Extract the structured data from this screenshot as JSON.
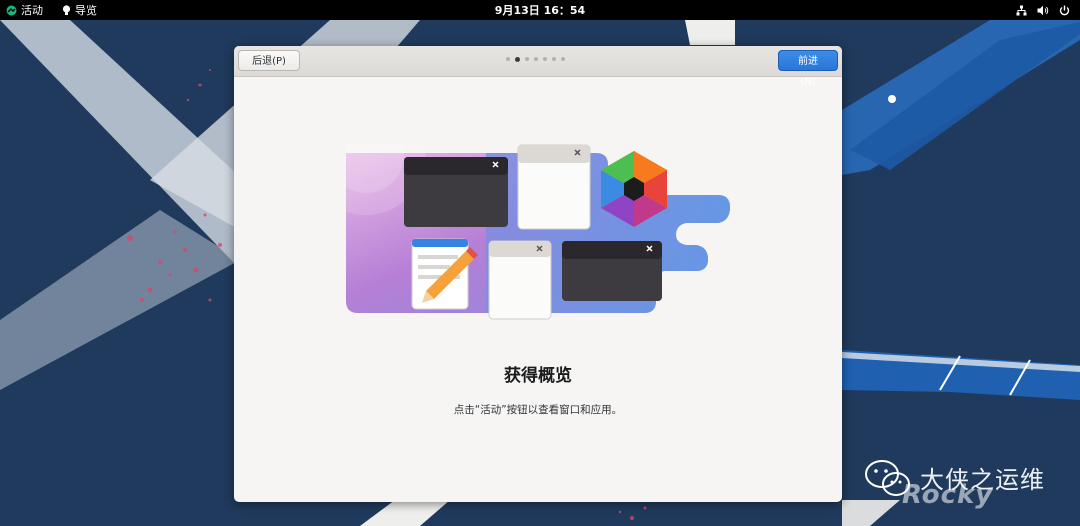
{
  "topbar": {
    "activities": "活动",
    "guide": "导览",
    "clock": "9月13日 16：54"
  },
  "dialog": {
    "back_label": "后退(P)",
    "next_label": "前进(N)",
    "pages": 7,
    "current_page": 2,
    "title": "获得概览",
    "description": "点击“活动”按钮以查看窗口和应用。"
  },
  "watermark": {
    "text": "大侠之运维",
    "logo_word": "Rocky"
  },
  "colors": {
    "accent": "#2a76d8",
    "topbar": "#000000",
    "desktop": "#1f3a5c"
  }
}
